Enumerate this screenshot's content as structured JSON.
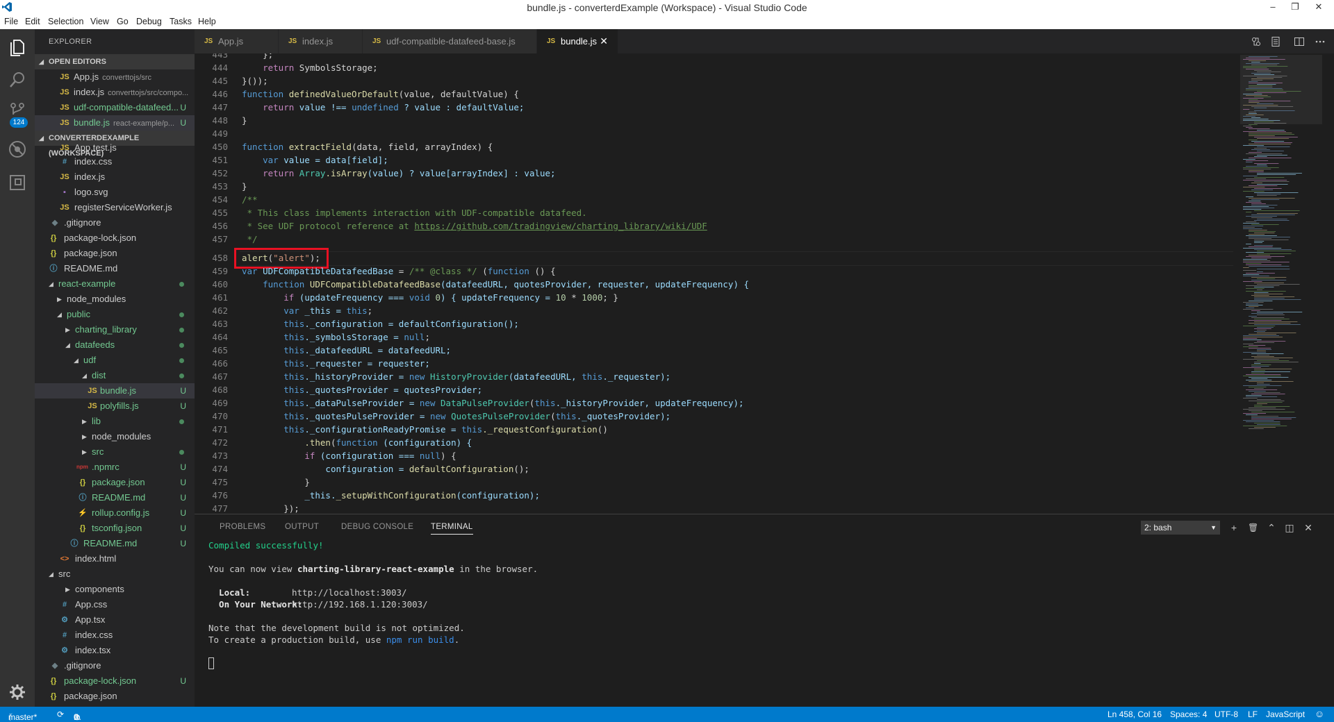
{
  "window": {
    "title": "bundle.js - converterdExample (Workspace) - Visual Studio Code",
    "controls": [
      "–",
      "❐",
      "✕"
    ]
  },
  "menu": [
    "File",
    "Edit",
    "Selection",
    "View",
    "Go",
    "Debug",
    "Tasks",
    "Help"
  ],
  "activity": {
    "icons": [
      "files-icon",
      "search-icon",
      "source-control-icon",
      "debug-icon",
      "extensions-icon"
    ],
    "scm_badge": "124"
  },
  "sidebar": {
    "title": "EXPLORER",
    "open_editors_header": "OPEN EDITORS",
    "open_editors": [
      {
        "icon": "JS",
        "name": "App.js",
        "desc": "converttojs/src",
        "status": ""
      },
      {
        "icon": "JS",
        "name": "index.js",
        "desc": "converttojs/src/compo...",
        "status": ""
      },
      {
        "icon": "JS",
        "name": "udf-compatible-datafeed...",
        "desc": "",
        "status": "U"
      },
      {
        "icon": "JS",
        "name": "bundle.js",
        "desc": "react-example/p...",
        "status": "U"
      }
    ],
    "workspace_header": "CONVERTERDEXAMPLE (WORKSPACE)",
    "tree": [
      {
        "icon": "JS",
        "name": "App.test.js"
      },
      {
        "icon": "#",
        "name": "index.css"
      },
      {
        "icon": "JS",
        "name": "index.js"
      },
      {
        "icon": "▪",
        "name": "logo.svg"
      },
      {
        "icon": "JS",
        "name": "registerServiceWorker.js"
      },
      {
        "icon": "◆",
        "name": ".gitignore"
      },
      {
        "icon": "{}",
        "name": "package-lock.json"
      },
      {
        "icon": "{}",
        "name": "package.json"
      },
      {
        "icon": "ⓘ",
        "name": "README.md"
      },
      {
        "icon": "",
        "name": "react-example"
      },
      {
        "icon": "",
        "name": "node_modules"
      },
      {
        "icon": "",
        "name": "public"
      },
      {
        "icon": "",
        "name": "charting_library"
      },
      {
        "icon": "",
        "name": "datafeeds"
      },
      {
        "icon": "",
        "name": "udf"
      },
      {
        "icon": "",
        "name": "dist"
      },
      {
        "icon": "JS",
        "name": "bundle.js",
        "status": "U"
      },
      {
        "icon": "JS",
        "name": "polyfills.js",
        "status": "U"
      },
      {
        "icon": "",
        "name": "lib"
      },
      {
        "icon": "",
        "name": "node_modules"
      },
      {
        "icon": "",
        "name": "src"
      },
      {
        "icon": "npm",
        "name": ".npmrc",
        "status": "U"
      },
      {
        "icon": "{}",
        "name": "package.json",
        "status": "U"
      },
      {
        "icon": "ⓘ",
        "name": "README.md",
        "status": "U"
      },
      {
        "icon": "⚡",
        "name": "rollup.config.js",
        "status": "U"
      },
      {
        "icon": "{}",
        "name": "tsconfig.json",
        "status": "U"
      },
      {
        "icon": "ⓘ",
        "name": "README.md",
        "status": "U"
      },
      {
        "icon": "<>",
        "name": "index.html"
      },
      {
        "icon": "",
        "name": "src"
      },
      {
        "icon": "",
        "name": "components"
      },
      {
        "icon": "#",
        "name": "App.css"
      },
      {
        "icon": "⚙",
        "name": "App.tsx"
      },
      {
        "icon": "#",
        "name": "index.css"
      },
      {
        "icon": "⚙",
        "name": "index.tsx"
      },
      {
        "icon": "◆",
        "name": ".gitignore"
      },
      {
        "icon": "{}",
        "name": "package-lock.json",
        "status": "U"
      },
      {
        "icon": "{}",
        "name": "package.json"
      }
    ]
  },
  "tabs": [
    {
      "icon": "JS",
      "label": "App.js"
    },
    {
      "icon": "JS",
      "label": "index.js"
    },
    {
      "icon": "JS",
      "label": "udf-compatible-datafeed-base.js"
    },
    {
      "icon": "JS",
      "label": "bundle.js",
      "close": "✕"
    }
  ],
  "editor": {
    "line_numbers": [
      "443",
      "444",
      "445",
      "446",
      "447",
      "448",
      "449",
      "450",
      "451",
      "452",
      "453",
      "454",
      "455",
      "456",
      "457",
      "458",
      "459",
      "460",
      "461",
      "462",
      "463",
      "464",
      "465",
      "466",
      "467",
      "468",
      "469",
      "470",
      "471",
      "472",
      "473",
      "474",
      "475",
      "476",
      "477"
    ],
    "text": {
      "l443": "    };",
      "l444_a": "return",
      "l444_b": "SymbolsStorage;",
      "l445": "}());",
      "l446_kw": "function",
      "l446_fn": "definedValueOrDefault",
      "l446_rest": "(value, defaultValue) {",
      "l447_kw": "return",
      "l447_a": "value !==",
      "l447_b": "undefined",
      "l447_c": "? value : defaultValue;",
      "l448": "}",
      "l450_kw": "function",
      "l450_fn": "extractField",
      "l450_rest": "(data, field, arrayIndex) {",
      "l451_kw": "var",
      "l451_rest": "value = data[field];",
      "l452_kw": "return",
      "l452_ty": "Array",
      "l452_fn": ".isArray",
      "l452_rest": "(value) ? value[arrayIndex] : value;",
      "l453": "}",
      "l454": "/**",
      "l455": " * This class implements interaction with UDF-compatible datafeed.",
      "l456_a": " * See UDF protocol reference at ",
      "l456_link": "https://github.com/tradingview/charting_library/wiki/UDF",
      "l457": " */",
      "l458_fn": "alert",
      "l458_str": "\"alert\"",
      "l459_kw": "var",
      "l459_name": "UDFCompatibleDatafeedBase",
      "l459_cm": "/** @class */",
      "l459_kw2": "function",
      "l460_kw": "function",
      "l460_fn": "UDFCompatibleDatafeedBase",
      "l460_rest": "(datafeedURL, quotesProvider, requester, updateFrequency) {",
      "l461_kw": "if",
      "l461_a": "(updateFrequency ===",
      "l461_void": "void",
      "l461_n0": "0",
      "l461_b": ") { updateFrequency =",
      "l461_n1": "10",
      "l461_c": "*",
      "l461_n2": "1000",
      "l461_d": "; }",
      "l462_kw": "var",
      "l462_a": "_this =",
      "l462_this": "this",
      "l463_this": "this",
      "l463_rest": "._configuration = defaultConfiguration();",
      "l464_this": "this",
      "l464_rest": "._symbolsStorage =",
      "l464_null": "null",
      "l465_this": "this",
      "l465_rest": "._datafeedURL = datafeedURL;",
      "l466_this": "this",
      "l466_rest": "._requester = requester;",
      "l467_this": "this",
      "l467_a": "._historyProvider =",
      "l467_new": "new",
      "l467_ty": "HistoryProvider",
      "l467_b": "(datafeedURL,",
      "l467_this2": "this",
      "l467_c": "._requester);",
      "l468_this": "this",
      "l468_rest": "._quotesProvider = quotesProvider;",
      "l469_this": "this",
      "l469_a": "._dataPulseProvider =",
      "l469_new": "new",
      "l469_ty": "DataPulseProvider",
      "l469_b": "(",
      "l469_this2": "this",
      "l469_c": "._historyProvider, updateFrequency);",
      "l470_this": "this",
      "l470_a": "._quotesPulseProvider =",
      "l470_new": "new",
      "l470_ty": "QuotesPulseProvider",
      "l470_b": "(",
      "l470_this2": "this",
      "l470_c": "._quotesProvider);",
      "l471_this": "this",
      "l471_a": "._configurationReadyPromise =",
      "l471_this2": "this",
      "l471_fn": "._requestConfiguration",
      "l471_b": "()",
      "l472_fn": ".then",
      "l472_a": "(",
      "l472_kw": "function",
      "l472_b": "(configuration) {",
      "l473_kw": "if",
      "l473_a": "(configuration ===",
      "l473_null": "null",
      "l473_b": ") {",
      "l474_a": "configuration =",
      "l474_fn": "defaultConfiguration",
      "l474_b": "();",
      "l475": "}",
      "l476_a": "_this.",
      "l476_fn": "_setupWithConfiguration",
      "l476_b": "(configuration);",
      "l477": "});"
    }
  },
  "panel": {
    "tabs": [
      "PROBLEMS",
      "OUTPUT",
      "DEBUG CONSOLE",
      "TERMINAL"
    ],
    "terminal_select": "2: bash",
    "buttons": [
      "+",
      "🗑",
      "⌃",
      "◫",
      "✕"
    ],
    "terminal": {
      "compiled": "Compiled successfully!",
      "view_a": "You can now view ",
      "view_app": "charting-library-react-example",
      "view_b": " in the browser.",
      "local_label": "  Local:",
      "local_url": "http://localhost:3003/",
      "network_label": "  On Your Network:",
      "network_url": "http://192.168.1.120:3003/",
      "note": "Note that the development build is not optimized.",
      "prod_a": "To create a production build, use ",
      "prod_cmd": "npm run build",
      "prod_b": "."
    }
  },
  "status": {
    "branch": "master*",
    "sync": "⟳",
    "errors": "0",
    "warnings": "0",
    "position": "Ln 458, Col 16",
    "spaces": "Spaces: 4",
    "encoding": "UTF-8",
    "eol": "LF",
    "language": "JavaScript",
    "feedback": "☺"
  },
  "colors": {
    "accent": "#007acc",
    "highlight_box": "#e81123"
  }
}
